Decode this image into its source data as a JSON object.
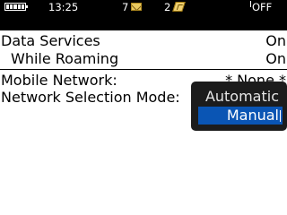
{
  "status_bar": {
    "time": "13:25",
    "message_count": "7",
    "bbm_count": "2",
    "radio_status": "OFF",
    "icons": {
      "battery": "battery-icon",
      "messages": "envelope-icon",
      "bbm": "bbm-icon"
    }
  },
  "settings": {
    "data_services": {
      "label": "Data Services",
      "value": "On"
    },
    "while_roaming": {
      "label": "While Roaming",
      "value": "On"
    },
    "mobile_network": {
      "label": "Mobile Network:",
      "value": "* None *"
    },
    "network_selection_mode": {
      "label": "Network Selection Mode:"
    }
  },
  "popup": {
    "options": [
      "Automatic",
      "Manual"
    ],
    "selected": "Manual"
  },
  "colors": {
    "status_bar_bg": "#000000",
    "popup_bg": "#1c1c1c",
    "highlight": "#0a55b4"
  }
}
